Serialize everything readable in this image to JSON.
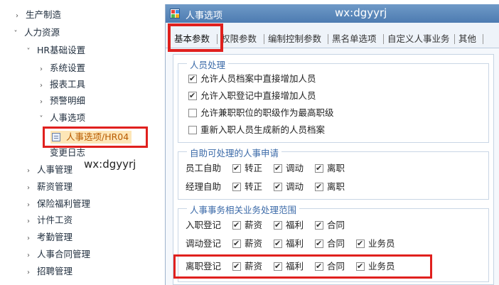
{
  "tree": {
    "items": [
      {
        "label": "生产制造",
        "arrow": "›",
        "expanded": false
      },
      {
        "label": "人力资源",
        "arrow": "›",
        "expanded": true
      },
      {
        "label": "HR基础设置",
        "arrow": "›",
        "expanded": true
      },
      {
        "label": "系统设置",
        "arrow": "›",
        "expanded": false
      },
      {
        "label": "报表工具",
        "arrow": "›",
        "expanded": false
      },
      {
        "label": "预警明细",
        "arrow": "›",
        "expanded": false
      },
      {
        "label": "人事选项",
        "arrow": "›",
        "expanded": true
      },
      {
        "label": "变更日志",
        "arrow": "›",
        "expanded": false
      },
      {
        "label": "人事管理",
        "arrow": "›",
        "expanded": false
      },
      {
        "label": "薪资管理",
        "arrow": "›",
        "expanded": false
      },
      {
        "label": "保险福利管理",
        "arrow": "›",
        "expanded": false
      },
      {
        "label": "计件工资",
        "arrow": "›",
        "expanded": false
      },
      {
        "label": "考勤管理",
        "arrow": "›",
        "expanded": false
      },
      {
        "label": "人事合同管理",
        "arrow": "›",
        "expanded": false
      },
      {
        "label": "招聘管理",
        "arrow": "›",
        "expanded": false
      }
    ],
    "selected_leaf": "人事选项/HR04",
    "watermark": "wx:dgyyrj"
  },
  "dialog": {
    "title": "人事选项",
    "watermark": "wx:dgyyrj",
    "tabs": [
      {
        "label": "基本参数",
        "active": true
      },
      {
        "label": "权限参数",
        "active": false
      },
      {
        "label": "编制控制参数",
        "active": false
      },
      {
        "label": "黑名单选项",
        "active": false
      },
      {
        "label": "自定义人事业务",
        "active": false
      },
      {
        "label": "其他",
        "active": false
      }
    ],
    "group_personnel": {
      "legend": "人员处理",
      "options": [
        {
          "label": "允许人员档案中直接增加人员",
          "checked": true
        },
        {
          "label": "允许入职登记中直接增加人员",
          "checked": true
        },
        {
          "label": "允许兼职职位的职级作为最高职级",
          "checked": false
        },
        {
          "label": "重新入职人员生成新的人员档案",
          "checked": false
        }
      ]
    },
    "group_selfservice": {
      "legend": "自助可处理的人事申请",
      "rows": [
        {
          "label": "员工自助",
          "options": [
            {
              "label": "转正",
              "checked": true
            },
            {
              "label": "调动",
              "checked": true
            },
            {
              "label": "离职",
              "checked": true
            }
          ]
        },
        {
          "label": "经理自助",
          "options": [
            {
              "label": "转正",
              "checked": true
            },
            {
              "label": "调动",
              "checked": true
            },
            {
              "label": "离职",
              "checked": true
            }
          ]
        }
      ]
    },
    "group_scope": {
      "legend": "人事事务相关业务处理范围",
      "rows": [
        {
          "label": "入职登记",
          "options": [
            {
              "label": "薪资",
              "checked": true
            },
            {
              "label": "福利",
              "checked": true
            },
            {
              "label": "合同",
              "checked": true
            }
          ]
        },
        {
          "label": "调动登记",
          "options": [
            {
              "label": "薪资",
              "checked": true
            },
            {
              "label": "福利",
              "checked": true
            },
            {
              "label": "合同",
              "checked": true
            },
            {
              "label": "业务员",
              "checked": true
            }
          ]
        },
        {
          "label": "离职登记",
          "options": [
            {
              "label": "薪资",
              "checked": true
            },
            {
              "label": "福利",
              "checked": true
            },
            {
              "label": "合同",
              "checked": true
            },
            {
              "label": "业务员",
              "checked": true
            }
          ]
        }
      ]
    }
  },
  "colors": {
    "highlight": "#e0201e",
    "titlebar": "#4d7bb1",
    "legend_text": "#3b6aa8",
    "selected_bg": "#fde6b7"
  }
}
